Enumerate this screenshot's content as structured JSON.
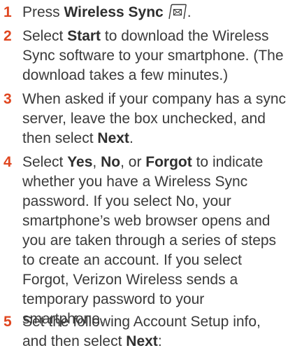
{
  "steps": [
    {
      "number": "1",
      "pre": "Press ",
      "bold": "Wireless Sync",
      "post": ".",
      "icon": "wireless-sync-key-icon"
    },
    {
      "number": "2",
      "l1_pre": "Select ",
      "l1_bold": "Start",
      "l1_post": " to download the Wireless",
      "l2": "Sync software to your smartphone. (The",
      "l3": "download takes a few minutes.)"
    },
    {
      "number": "3",
      "l1": "When asked if your company has a sync",
      "l2": "server, leave the box unchecked, and",
      "l3_pre": "then select ",
      "l3_bold": "Next",
      "l3_post": "."
    },
    {
      "number": "4",
      "l1_pre": "Select ",
      "l1_bold1": "Yes",
      "l1_mid1": ", ",
      "l1_bold2": "No",
      "l1_mid2": ", or ",
      "l1_bold3": "Forgot",
      "l1_post": " to indicate",
      "l2": "whether you have a Wireless Sync",
      "l3": "password. If you select No, your",
      "l4": "smartphone’s web browser opens and",
      "l5": "you are taken through a series of steps",
      "l6": "to create an account. If you select",
      "l7": "Forgot, Verizon Wireless sends a",
      "l8": "temporary password to your",
      "l9": "smartphone."
    },
    {
      "number": "5",
      "l1": "Set the following Account Setup info,",
      "l2_pre": "and then select ",
      "l2_bold": "Next",
      "l2_post": ":"
    }
  ]
}
